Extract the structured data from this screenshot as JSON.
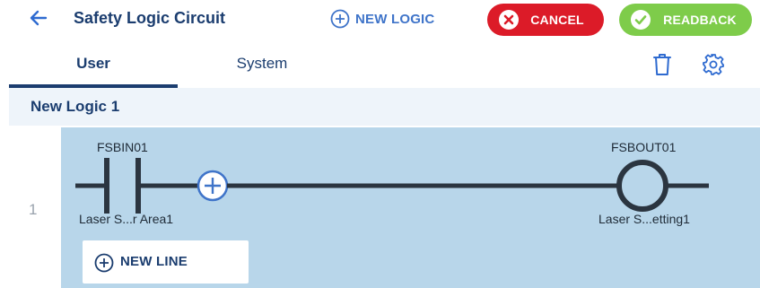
{
  "header": {
    "title": "Safety Logic Circuit",
    "new_logic_label": "NEW LOGIC",
    "cancel_label": "CANCEL",
    "readback_label": "READBACK"
  },
  "tabs": [
    {
      "label": "User",
      "active": true
    },
    {
      "label": "System",
      "active": false
    }
  ],
  "logic": {
    "name": "New Logic 1",
    "rungs": [
      {
        "number": "1",
        "input": {
          "name": "FSBIN01",
          "description": "Laser S...r Area1"
        },
        "output": {
          "name": "FSBOUT01",
          "description": "Laser S...etting1"
        }
      }
    ],
    "new_line_label": "NEW LINE"
  },
  "colors": {
    "primary": "#1b3d6f",
    "link": "#3f74c9",
    "cancel": "#dc1b28",
    "readback": "#7ecc4a",
    "rung_bg": "#b8d6ea",
    "header_bg": "#eef4fa",
    "wire": "#2b3540"
  },
  "icons": {
    "back": "arrow-left-icon",
    "new_logic": "plus-circle-icon",
    "cancel": "x-circle-icon",
    "readback": "check-circle-icon",
    "delete": "trash-icon",
    "settings": "gear-icon",
    "insert": "plus-circle-icon",
    "new_line": "plus-circle-icon"
  }
}
